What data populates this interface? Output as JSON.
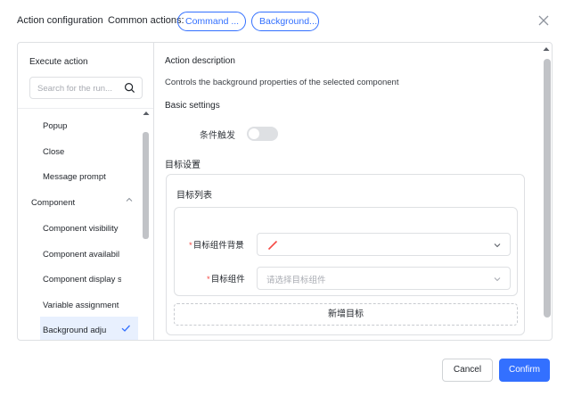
{
  "header": {
    "title": "Action configuration",
    "common_label": "Common actions:",
    "chips": [
      "Command ...",
      "Background..."
    ]
  },
  "left_panel": {
    "title": "Execute action",
    "search_placeholder": "Search for the run...",
    "items": [
      {
        "label": "Popup"
      },
      {
        "label": "Close"
      },
      {
        "label": "Message prompt"
      },
      {
        "label": "Component"
      },
      {
        "label": "Component visibility"
      },
      {
        "label": "Component availabil"
      },
      {
        "label": "Component display s"
      },
      {
        "label": "Variable assignment"
      },
      {
        "label": "Background adju"
      }
    ],
    "selected": "Background adju"
  },
  "right_panel": {
    "desc_title": "Action description",
    "desc_text": "Controls the background properties of the selected component",
    "basic_settings": "Basic settings",
    "toggle_label": "条件触发",
    "toggle_on": false,
    "target_settings": "目标设置",
    "target_list": "目标列表",
    "field1_label": "目标组件背景",
    "field2_label": "目标组件",
    "field2_placeholder": "请选择目标组件",
    "add_target": "新增目标"
  },
  "footer": {
    "cancel": "Cancel",
    "confirm": "Confirm"
  },
  "colors": {
    "accent": "#3370ff",
    "required": "#f54a45",
    "selected_bg": "#e8f0fe"
  },
  "icons": [
    "close-icon",
    "search-icon",
    "chevron-up-icon",
    "check-icon",
    "chevron-down-icon",
    "no-color-swatch-icon"
  ]
}
